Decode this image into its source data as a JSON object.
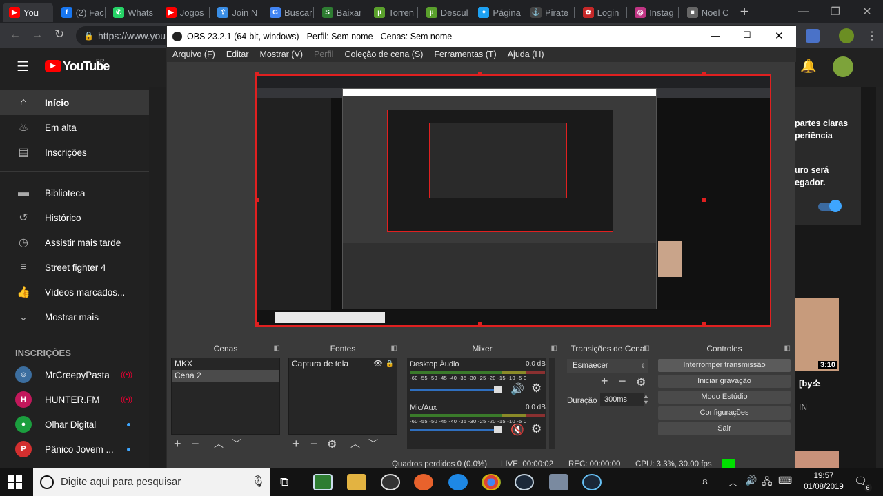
{
  "browser": {
    "tabs": [
      {
        "label": "You",
        "favicon": "youtube-icon",
        "color": "#ff0000",
        "glyph": "▶"
      },
      {
        "label": "(2) Fac",
        "favicon": "facebook-icon",
        "color": "#1877f2",
        "glyph": "f"
      },
      {
        "label": "Whats",
        "favicon": "whatsapp-icon",
        "color": "#25d366",
        "glyph": "✆"
      },
      {
        "label": "Jogos",
        "favicon": "youtube-icon",
        "color": "#ff0000",
        "glyph": "▶"
      },
      {
        "label": "Join N",
        "favicon": "join-icon",
        "color": "#3a8ee6",
        "glyph": "⇪"
      },
      {
        "label": "Buscar",
        "favicon": "translate-icon",
        "color": "#4285f4",
        "glyph": "G"
      },
      {
        "label": "Baixar",
        "favicon": "baixar-icon",
        "color": "#2e7d32",
        "glyph": "S"
      },
      {
        "label": "Torren",
        "favicon": "torrent-icon",
        "color": "#5aa02c",
        "glyph": "µ"
      },
      {
        "label": "Descul",
        "favicon": "torrent-icon",
        "color": "#5aa02c",
        "glyph": "µ"
      },
      {
        "label": "Página",
        "favicon": "twitter-icon",
        "color": "#1da1f2",
        "glyph": "✦"
      },
      {
        "label": "Pirate",
        "favicon": "pirate-icon",
        "color": "#444444",
        "glyph": "⚓"
      },
      {
        "label": "Login",
        "favicon": "login-icon",
        "color": "#c62828",
        "glyph": "✿"
      },
      {
        "label": "Instag",
        "favicon": "instagram-icon",
        "color": "#c13584",
        "glyph": "◎"
      },
      {
        "label": "Noel C",
        "favicon": "noel-icon",
        "color": "#666666",
        "glyph": "■"
      }
    ],
    "url": "https://www.you"
  },
  "youtube": {
    "logo": "YouTube",
    "region": "BR",
    "nav": [
      {
        "label": "Início",
        "icon": "home-icon",
        "glyph": "⌂"
      },
      {
        "label": "Em alta",
        "icon": "trending-icon",
        "glyph": "♨"
      },
      {
        "label": "Inscrições",
        "icon": "subscriptions-icon",
        "glyph": "▤"
      },
      {
        "label": "Biblioteca",
        "icon": "library-icon",
        "glyph": "▬"
      },
      {
        "label": "Histórico",
        "icon": "history-icon",
        "glyph": "↺"
      },
      {
        "label": "Assistir mais tarde",
        "icon": "watch-later-icon",
        "glyph": "◷"
      },
      {
        "label": "Street fighter 4",
        "icon": "playlist-icon",
        "glyph": "≡"
      },
      {
        "label": "Vídeos marcados...",
        "icon": "like-icon",
        "glyph": "👍"
      },
      {
        "label": "Mostrar mais",
        "icon": "chevron-down-icon",
        "glyph": "⌄"
      }
    ],
    "subs_heading": "INSCRIÇÕES",
    "subs": [
      {
        "name": "MrCreepyPasta",
        "live": "((•))",
        "color": "#3c6e9f",
        "glyph": "☺"
      },
      {
        "name": "HUNTER.FM",
        "live": "((•))",
        "color": "#c2185b",
        "glyph": "H"
      },
      {
        "name": "Olhar Digital",
        "dot": true,
        "color": "#1b9e3e",
        "glyph": "●"
      },
      {
        "name": "Pânico Jovem ...",
        "dot": true,
        "color": "#d32f2f",
        "glyph": "P"
      }
    ],
    "right_panel": {
      "text1": "partes claras",
      "text2": "periência",
      "text3": "uro será",
      "text4": "egador.",
      "video_duration": "3:10",
      "video_title": "[by소",
      "video_sub": "IN"
    }
  },
  "obs": {
    "title": "OBS 23.2.1 (64-bit, windows) - Perfil: Sem nome - Cenas: Sem nome",
    "menu": [
      {
        "label": "Arquivo (F)",
        "disabled": false
      },
      {
        "label": "Editar",
        "disabled": false
      },
      {
        "label": "Mostrar (V)",
        "disabled": false
      },
      {
        "label": "Perfil",
        "disabled": true
      },
      {
        "label": "Coleção de cena (S)",
        "disabled": false
      },
      {
        "label": "Ferramentas (T)",
        "disabled": false
      },
      {
        "label": "Ajuda (H)",
        "disabled": false
      }
    ],
    "docks": {
      "scenes_title": "Cenas",
      "sources_title": "Fontes",
      "mixer_title": "Mixer",
      "transitions_title": "Transições de Cena",
      "controls_title": "Controles"
    },
    "scenes": [
      "MKX",
      "Cena 2"
    ],
    "sources": [
      "Captura de tela"
    ],
    "mixer": [
      {
        "name": "Desktop Áudio",
        "db": "0.0 dB",
        "muted": false
      },
      {
        "name": "Mic/Aux",
        "db": "0.0 dB",
        "muted": true
      }
    ],
    "meter_ticks": "-60 -55 -50 -45 -40 -35 -30 -25 -20 -15 -10 -5 0",
    "transitions": {
      "type": "Esmaecer",
      "duration_label": "Duração",
      "duration": "300ms"
    },
    "controls": [
      "Interromper transmissão",
      "Iniciar gravação",
      "Modo Estúdio",
      "Configurações",
      "Sair"
    ],
    "status": {
      "dropped": "Quadros perdidos 0 (0.0%)",
      "live": "LIVE: 00:00:02",
      "rec": "REC: 00:00:00",
      "cpu": "CPU: 3.3%, 30.00 fps",
      "indicator_color": "#00e000"
    }
  },
  "taskbar": {
    "search_placeholder": "Digite aqui para pesquisar",
    "time": "19:57",
    "date": "01/08/2019",
    "notifications": "6"
  }
}
